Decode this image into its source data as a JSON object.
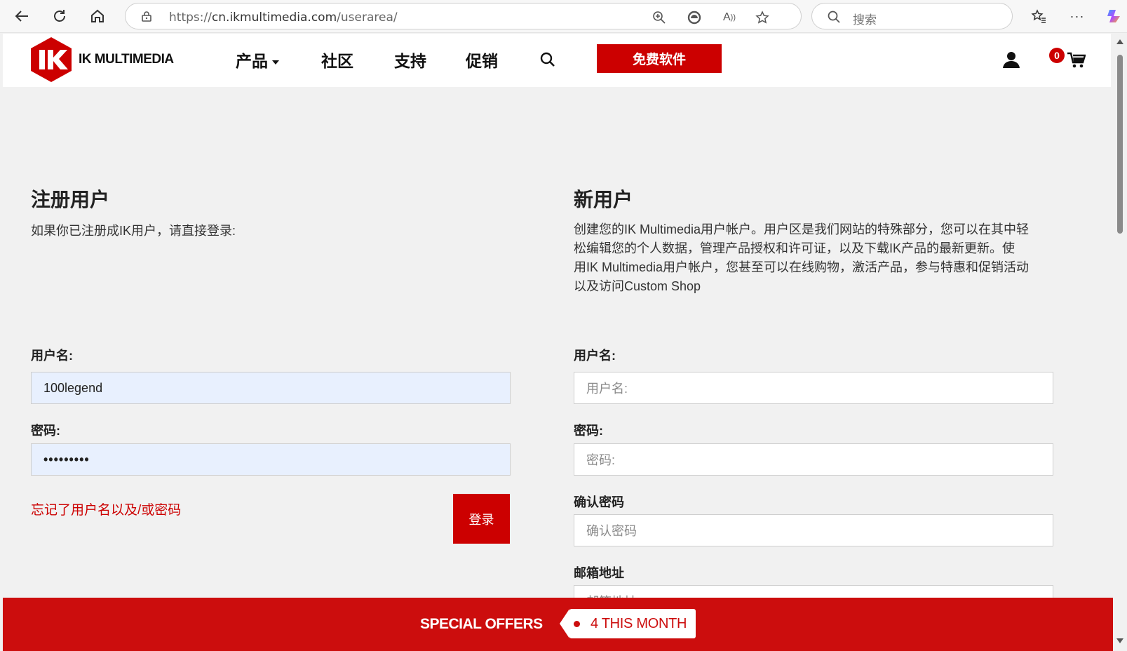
{
  "browser": {
    "url_prefix": "https://",
    "url_host": "cn.ikmultimedia.com",
    "url_path": "/userarea/",
    "search_placeholder": "搜索"
  },
  "header": {
    "brand": "IK MULTIMEDIA",
    "nav": [
      "产品",
      "社区",
      "支持",
      "促销"
    ],
    "free_button": "免费软件",
    "cart_count": "0"
  },
  "login": {
    "title": "注册用户",
    "subtitle": "如果你已注册成IK用户，请直接登录:",
    "username_label": "用户名:",
    "username_value": "100legend",
    "password_label": "密码:",
    "password_value": "•••••••••",
    "forgot_link": "忘记了用户名以及/或密码",
    "login_button": "登录"
  },
  "register": {
    "title": "新用户",
    "description": [
      "创建您的IK Multimedia用户帐户。用户区是我们网站的特殊部分，您可以在其中轻",
      "松编辑您的个人数据，管理产品授权和许可证，以及下载IK产品的最新更新。使",
      "用IK Multimedia用户帐户，您甚至可以在线购物，激活产品，参与特惠和促销活动",
      "以及访问Custom Shop"
    ],
    "username_label": "用户名:",
    "username_placeholder": "用户名:",
    "password_label": "密码:",
    "password_placeholder": "密码:",
    "confirm_label": "确认密码",
    "confirm_placeholder": "确认密码",
    "email_label": "邮箱地址",
    "email_placeholder": "邮箱地址"
  },
  "offers": {
    "label": "SPECIAL OFFERS",
    "pill": "4 THIS MONTH"
  },
  "colors": {
    "accent": "#cc0000",
    "autofill": "#e8f0fe"
  }
}
